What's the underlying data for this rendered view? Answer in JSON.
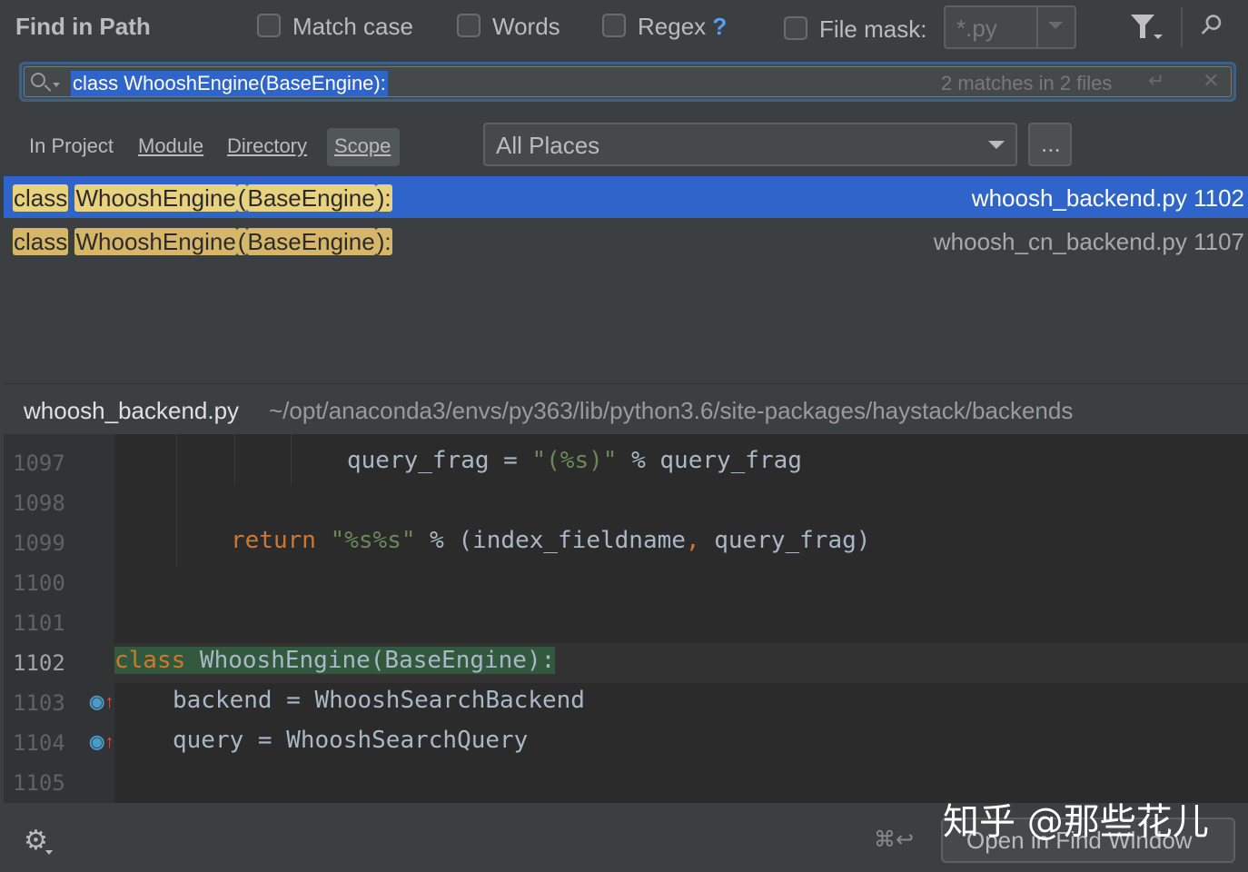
{
  "header": {
    "title": "Find in Path",
    "match_case": "Match case",
    "words": "Words",
    "regex": "Regex",
    "regex_help": "?",
    "file_mask_label": "File mask:",
    "file_mask_placeholder": "*.py"
  },
  "search": {
    "query": "class WhooshEngine(BaseEngine):",
    "match_count": "2 matches in 2 files"
  },
  "scope": {
    "tabs": [
      {
        "label": "In Project"
      },
      {
        "label": "Module"
      },
      {
        "label": "Directory"
      },
      {
        "label": "Scope"
      }
    ],
    "active_tab": "Scope",
    "selected_scope": "All Places",
    "more": "..."
  },
  "results": [
    {
      "text_parts": [
        "class",
        "WhooshEngine",
        "(",
        "BaseEngine",
        "):"
      ],
      "file": "whoosh_backend.py 1102",
      "selected": true
    },
    {
      "text_parts": [
        "class",
        "WhooshEngine",
        "(",
        "BaseEngine",
        "):"
      ],
      "file": "whoosh_cn_backend.py 1107",
      "selected": false
    }
  ],
  "preview": {
    "file_name": "whoosh_backend.py",
    "file_path": "~/opt/anaconda3/envs/py363/lib/python3.6/site-packages/haystack/backends",
    "line_numbers": [
      "1097",
      "1098",
      "1099",
      "1100",
      "1101",
      "1102",
      "1103",
      "1104",
      "1105"
    ],
    "current_line": "1102",
    "code": {
      "l1097_a": "query_frag = ",
      "l1097_str": "\"(%s)\"",
      "l1097_b": " % query_frag",
      "l1099_kw": "return",
      "l1099_str": "\"%s%s\"",
      "l1099_b": " % (index_fieldname",
      "l1099_comma": ",",
      "l1099_c": " query_frag)",
      "l1102_kw": "class",
      "l1102_b": " WhooshEngine(BaseEngine):",
      "l1103": "backend = WhooshSearchBackend",
      "l1104": "query = WhooshSearchQuery"
    }
  },
  "footer": {
    "shortcut": "⌘↩",
    "open_button": "Open in Find Window"
  },
  "watermark": "知乎 @那些花儿",
  "colors": {
    "selection": "#2f65ca",
    "match_highlight": "#d6b769",
    "keyword": "#cc7832",
    "string": "#6a8759"
  }
}
